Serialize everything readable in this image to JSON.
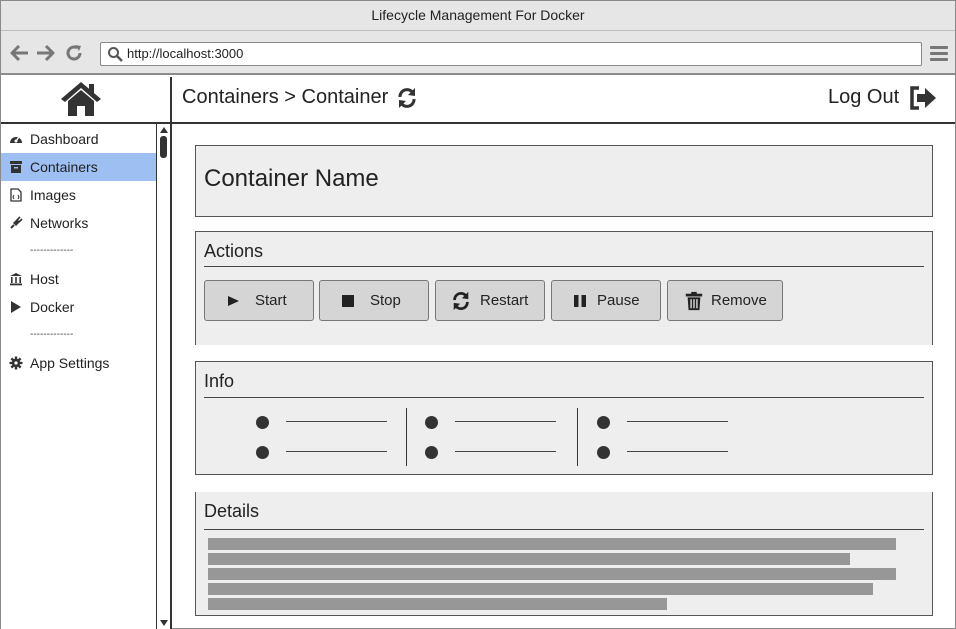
{
  "window": {
    "title": "Lifecycle Management For Docker"
  },
  "browser": {
    "url": "http://localhost:3000",
    "back_icon": "arrow-left-icon",
    "forward_icon": "arrow-right-icon",
    "reload_icon": "reload-icon",
    "menu_icon": "hamburger-menu-icon"
  },
  "header": {
    "breadcrumb": "Containers > Container",
    "logout_label": "Log Out",
    "home_icon": "home-icon",
    "refresh_icon": "refresh-icon",
    "logout_icon": "sign-out-icon"
  },
  "sidebar": {
    "items": [
      {
        "label": "Dashboard",
        "icon": "dashboard-icon",
        "active": false
      },
      {
        "label": "Containers",
        "icon": "archive-icon",
        "active": true
      },
      {
        "label": "Images",
        "icon": "image-file-icon",
        "active": false
      },
      {
        "label": "Networks",
        "icon": "plug-icon",
        "active": false
      },
      {
        "label": "Host",
        "icon": "bank-icon",
        "active": false
      },
      {
        "label": "Docker",
        "icon": "play-icon",
        "active": false
      },
      {
        "label": "App Settings",
        "icon": "gear-icon",
        "active": false
      }
    ],
    "separator": "-------------",
    "active_color": "#9dbff2"
  },
  "container": {
    "name": "Container Name"
  },
  "actions": {
    "title": "Actions",
    "buttons": [
      {
        "label": "Start",
        "icon": "play-icon"
      },
      {
        "label": "Stop",
        "icon": "stop-icon"
      },
      {
        "label": "Restart",
        "icon": "refresh-icon"
      },
      {
        "label": "Pause",
        "icon": "pause-icon"
      },
      {
        "label": "Remove",
        "icon": "trash-icon"
      }
    ]
  },
  "info": {
    "title": "Info"
  },
  "details": {
    "title": "Details"
  }
}
